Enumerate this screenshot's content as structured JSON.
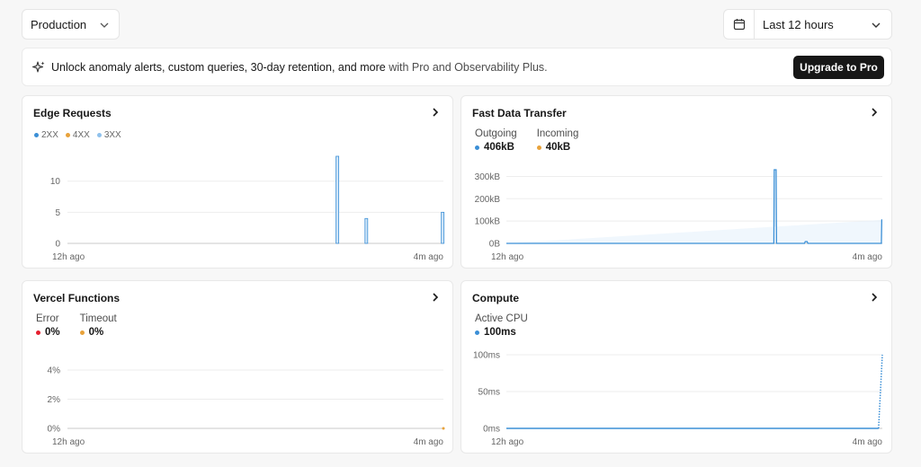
{
  "toolbar": {
    "environment": "Production",
    "time_range": "Last 12 hours"
  },
  "banner": {
    "text_strong": "Unlock anomaly alerts, custom queries, 30-day retention, and more",
    "text_muted": " with Pro and Observability Plus.",
    "button_label": "Upgrade to Pro"
  },
  "colors": {
    "blue": "#3b8fd6",
    "orange": "#e8a23b",
    "light_blue": "#8fc1ec",
    "red": "#e5202f"
  },
  "cards": {
    "edge_requests": {
      "title": "Edge Requests",
      "legend": [
        "2XX",
        "4XX",
        "3XX"
      ],
      "x_start": "12h ago",
      "x_end": "4m ago"
    },
    "fast_data_transfer": {
      "title": "Fast Data Transfer",
      "metrics": [
        {
          "label": "Outgoing",
          "value": "406kB"
        },
        {
          "label": "Incoming",
          "value": "40kB"
        }
      ],
      "x_start": "12h ago",
      "x_end": "4m ago"
    },
    "vercel_functions": {
      "title": "Vercel Functions",
      "metrics": [
        {
          "label": "Error",
          "value": "0%"
        },
        {
          "label": "Timeout",
          "value": "0%"
        }
      ],
      "x_start": "12h ago",
      "x_end": "4m ago"
    },
    "compute": {
      "title": "Compute",
      "metrics": [
        {
          "label": "Active CPU",
          "value": "100ms"
        }
      ],
      "x_start": "12h ago",
      "x_end": "4m ago"
    }
  },
  "chart_data": [
    {
      "type": "bar",
      "title": "Edge Requests",
      "x_axis": {
        "start_label": "12h ago",
        "end_label": "4m ago",
        "range": [
          0,
          1
        ]
      },
      "y_ticks": [
        {
          "value": 0,
          "label": "0"
        },
        {
          "value": 5,
          "label": "5"
        },
        {
          "value": 10,
          "label": "10"
        }
      ],
      "ylim": [
        0,
        14
      ],
      "grid": true,
      "series": [
        {
          "name": "2XX",
          "points": [
            {
              "x": 0.718,
              "y": 14
            },
            {
              "x": 0.795,
              "y": 4
            },
            {
              "x": 0.998,
              "y": 5
            }
          ]
        },
        {
          "name": "4XX",
          "points": []
        },
        {
          "name": "3XX",
          "points": []
        }
      ]
    },
    {
      "type": "line",
      "title": "Fast Data Transfer",
      "x_axis": {
        "start_label": "12h ago",
        "end_label": "4m ago",
        "range": [
          0,
          1
        ]
      },
      "y_ticks": [
        {
          "value": 0,
          "label": "0B"
        },
        {
          "value": 100,
          "label": "100kB"
        },
        {
          "value": 200,
          "label": "200kB"
        },
        {
          "value": 300,
          "label": "300kB"
        }
      ],
      "ylim": [
        0,
        330
      ],
      "grid": true,
      "series": [
        {
          "name": "Outgoing",
          "points": [
            {
              "x": 0,
              "y": 0
            },
            {
              "x": 0.7115,
              "y": 0
            },
            {
              "x": 0.7125,
              "y": 330
            },
            {
              "x": 0.7175,
              "y": 330
            },
            {
              "x": 0.7185,
              "y": 0
            },
            {
              "x": 0.793,
              "y": 0
            },
            {
              "x": 0.795,
              "y": 8
            },
            {
              "x": 0.8,
              "y": 8
            },
            {
              "x": 0.802,
              "y": 0
            },
            {
              "x": 0.9975,
              "y": 0
            },
            {
              "x": 0.9985,
              "y": 105
            },
            {
              "x": 1,
              "y": 105
            }
          ]
        },
        {
          "name": "Incoming",
          "points": []
        }
      ]
    },
    {
      "type": "line",
      "title": "Vercel Functions",
      "x_axis": {
        "start_label": "12h ago",
        "end_label": "4m ago",
        "range": [
          0,
          1
        ]
      },
      "y_ticks": [
        {
          "value": 0,
          "label": "0%"
        },
        {
          "value": 2,
          "label": "2%"
        },
        {
          "value": 4,
          "label": "4%"
        }
      ],
      "ylim": [
        0,
        4
      ],
      "grid": true,
      "series": [
        {
          "name": "Error",
          "points": []
        },
        {
          "name": "Timeout",
          "points": [
            {
              "x": 1,
              "y": 0
            }
          ]
        }
      ]
    },
    {
      "type": "line",
      "title": "Compute",
      "x_axis": {
        "start_label": "12h ago",
        "end_label": "4m ago",
        "range": [
          0,
          1
        ]
      },
      "y_ticks": [
        {
          "value": 0,
          "label": "0ms"
        },
        {
          "value": 50,
          "label": "50ms"
        },
        {
          "value": 100,
          "label": "100ms"
        }
      ],
      "ylim": [
        0,
        100
      ],
      "grid": true,
      "series": [
        {
          "name": "Active CPU",
          "points": [
            {
              "x": 0,
              "y": 0
            },
            {
              "x": 0.99,
              "y": 0
            },
            {
              "x": 1,
              "y": 100
            }
          ]
        }
      ]
    }
  ]
}
